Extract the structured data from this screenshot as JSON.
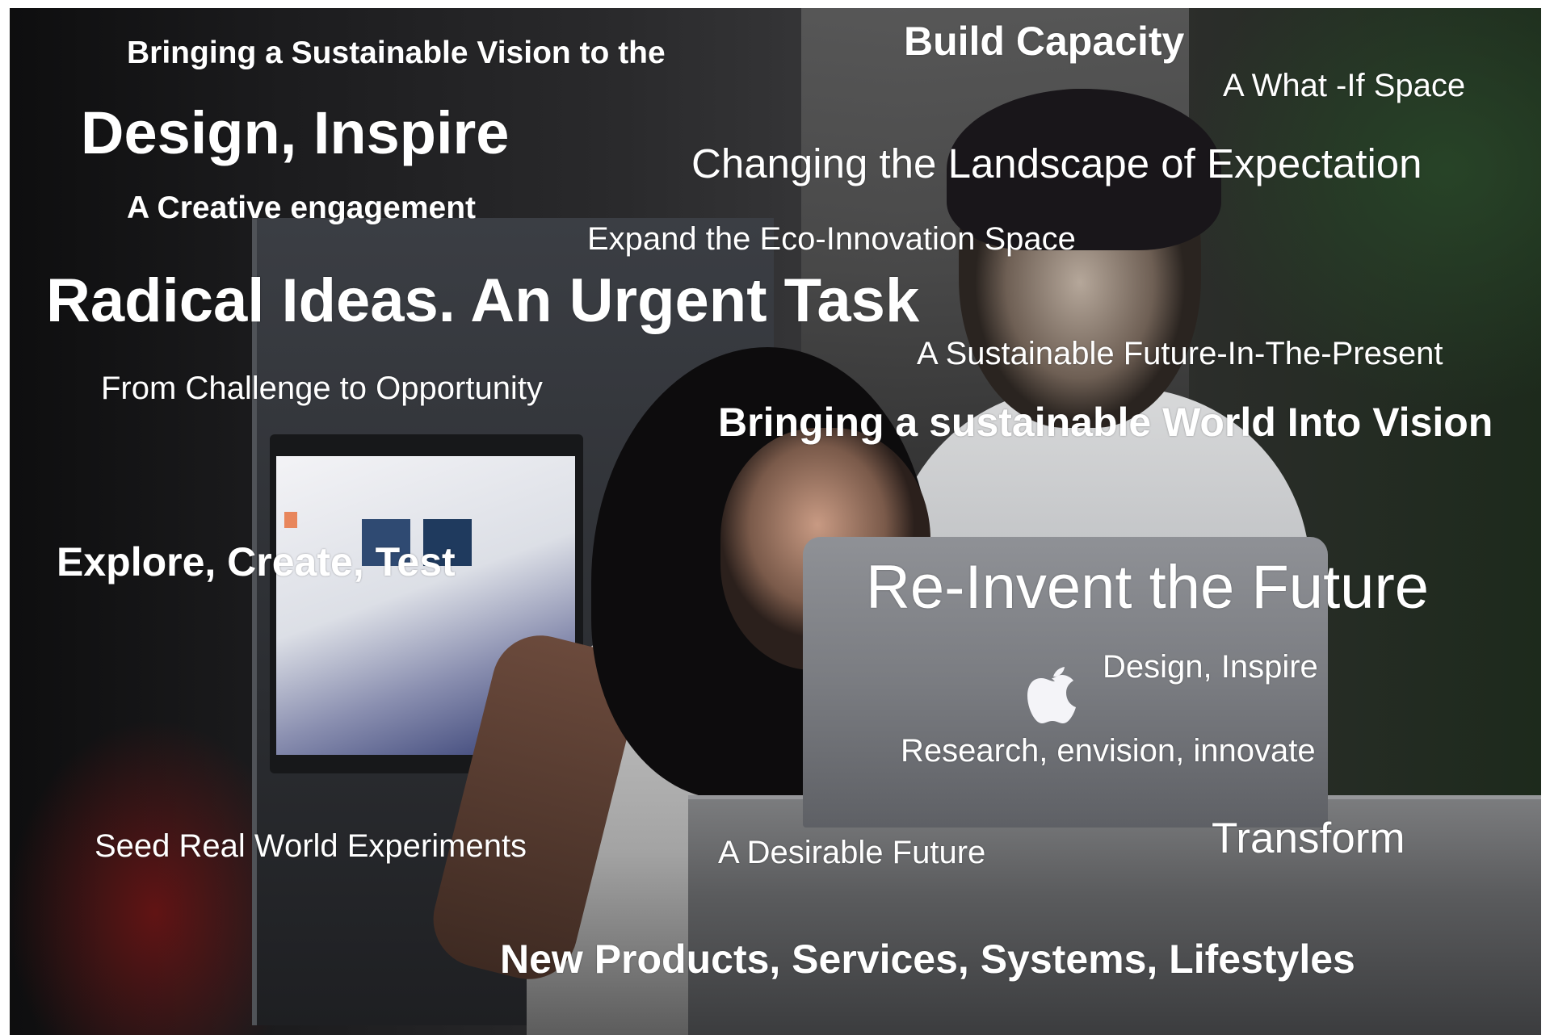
{
  "phrases": {
    "bringing_vision": "Bringing a Sustainable Vision to the",
    "build_capacity": "Build Capacity",
    "what_if_space": "A What -If Space",
    "design_inspire_large": "Design, Inspire",
    "changing_landscape": "Changing the Landscape of Expectation",
    "creative_engagement": "A Creative engagement",
    "expand_eco": "Expand the Eco-Innovation Space",
    "radical_ideas": "Radical Ideas. An Urgent Task",
    "sustainable_future_present": "A Sustainable Future-In-The-Present",
    "challenge_opportunity": "From Challenge to Opportunity",
    "sustainable_world_vision": "Bringing a sustainable World Into Vision",
    "explore_create_test": "Explore, Create, Test",
    "reinvent_future": "Re-Invent the Future",
    "design_inspire_small": "Design, Inspire",
    "research_envision": "Research, envision, innovate",
    "seed_experiments": "Seed Real World Experiments",
    "desirable_future": "A Desirable Future",
    "transform": "Transform",
    "new_products": "New Products, Services, Systems, Lifestyles"
  },
  "colors": {
    "text": "#ffffff",
    "background": "#1c1c1e"
  },
  "icons": {
    "logo": "apple-logo-icon"
  }
}
